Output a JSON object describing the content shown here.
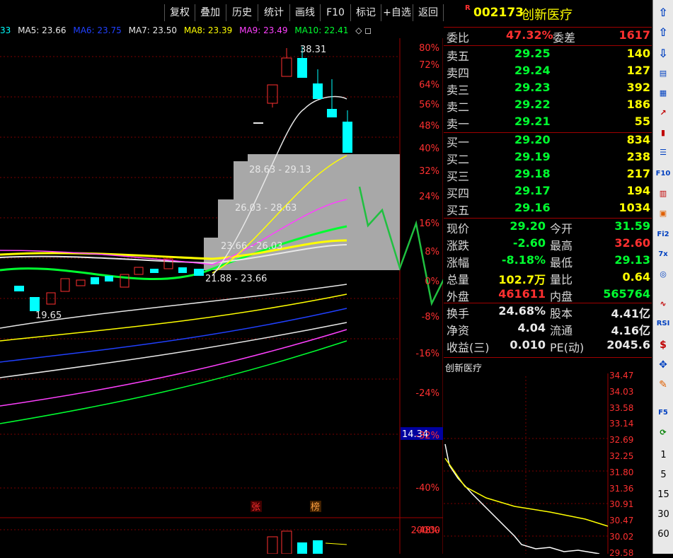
{
  "toolbar": {
    "buttons": [
      "复权",
      "叠加",
      "历史",
      "统计",
      "画线",
      "F10",
      "标记",
      "+自选",
      "返回"
    ]
  },
  "ma_legend": [
    {
      "label": "33",
      "color": "#00ffff"
    },
    {
      "label": "MA5: 23.66",
      "color": "#e8e8e8"
    },
    {
      "label": "MA6: 23.75",
      "color": "#2040ff"
    },
    {
      "label": "MA7: 23.50",
      "color": "#e8e8e8"
    },
    {
      "label": "MA8: 23.39",
      "color": "#ffff00"
    },
    {
      "label": "MA9: 23.49",
      "color": "#ff40ff"
    },
    {
      "label": "MA10: 22.41",
      "color": "#00ff30"
    }
  ],
  "main_chart": {
    "pct_labels": [
      "80%",
      "72%",
      "64%",
      "56%",
      "48%",
      "40%",
      "32%",
      "24%",
      "16%",
      "8%",
      "0%",
      "-8%",
      "-16%",
      "-24%",
      "-32%",
      "-40%",
      "-48%"
    ],
    "annotations": {
      "high": "38.31",
      "low": "19.65",
      "chip_ranges": [
        "28.63 - 29.13",
        "26.03 - 28.63",
        "23.66 - 26.03",
        "21.88 - 23.66"
      ],
      "price_tag": "14.34",
      "tag_zhang": "张",
      "tag_bang": "榜",
      "vol_label": "20000"
    }
  },
  "quote": {
    "flag": "R",
    "code": "002173",
    "name": "创新医疗",
    "weibi_label": "委比",
    "weibi_value": "47.32%",
    "weicha_label": "委差",
    "weicha_value": "1617",
    "asks": [
      {
        "label": "卖五",
        "price": "29.25",
        "vol": "140"
      },
      {
        "label": "卖四",
        "price": "29.24",
        "vol": "127"
      },
      {
        "label": "卖三",
        "price": "29.23",
        "vol": "392"
      },
      {
        "label": "卖二",
        "price": "29.22",
        "vol": "186"
      },
      {
        "label": "卖一",
        "price": "29.21",
        "vol": "55"
      }
    ],
    "bids": [
      {
        "label": "买一",
        "price": "29.20",
        "vol": "834"
      },
      {
        "label": "买二",
        "price": "29.19",
        "vol": "238"
      },
      {
        "label": "买三",
        "price": "29.18",
        "vol": "217"
      },
      {
        "label": "买四",
        "price": "29.17",
        "vol": "194"
      },
      {
        "label": "买五",
        "price": "29.16",
        "vol": "1034"
      }
    ],
    "stats": [
      {
        "l1": "现价",
        "v1": "29.20",
        "c1": "green",
        "l2": "今开",
        "v2": "31.59",
        "c2": "green"
      },
      {
        "l1": "涨跌",
        "v1": "-2.60",
        "c1": "green",
        "l2": "最高",
        "v2": "32.60",
        "c2": "red"
      },
      {
        "l1": "涨幅",
        "v1": "-8.18%",
        "c1": "green",
        "l2": "最低",
        "v2": "29.13",
        "c2": "green"
      },
      {
        "l1": "总量",
        "v1": "102.7万",
        "c1": "yellow",
        "l2": "量比",
        "v2": "0.64",
        "c2": "yellow"
      },
      {
        "l1": "外盘",
        "v1": "461611",
        "c1": "red",
        "l2": "内盘",
        "v2": "565764",
        "c2": "green"
      }
    ],
    "stats2": [
      {
        "l1": "换手",
        "v1": "24.68%",
        "c1": "white",
        "l2": "股本",
        "v2": "4.41亿",
        "c2": "white"
      },
      {
        "l1": "净资",
        "v1": "4.04",
        "c1": "white",
        "l2": "流通",
        "v2": "4.16亿",
        "c2": "white"
      },
      {
        "l1": "收益(三)",
        "v1": "0.010",
        "c1": "white",
        "l2": "PE(动)",
        "v2": "2045.6",
        "c2": "white"
      }
    ]
  },
  "mini_chart": {
    "title": "创新医疗",
    "price_labels": [
      "34.47",
      "34.03",
      "33.58",
      "33.14",
      "32.69",
      "32.25",
      "31.80",
      "31.36",
      "30.91",
      "30.47",
      "30.02",
      "29.58"
    ]
  },
  "sidebar": {
    "icons": [
      "up-arrow-icon",
      "top-arrow-icon",
      "cart-icon",
      "report-icon",
      "grid-icon",
      "line-chart-icon",
      "kline-icon",
      "list-icon",
      "f10-icon",
      "f11-icon",
      "calendar-icon",
      "f12-icon",
      "f70-icon",
      "circle-icon",
      "wave-icon",
      "rsi-icon",
      "dollar-icon",
      "move-icon",
      "pencil-icon",
      "f5-icon",
      "refresh-icon"
    ],
    "labels": {
      "f10": "F10",
      "f12": "Fi2",
      "f70": "7x",
      "rsi": "RSI",
      "f5": "F5"
    },
    "numbers": [
      "1",
      "5",
      "15",
      "30",
      "60"
    ]
  }
}
